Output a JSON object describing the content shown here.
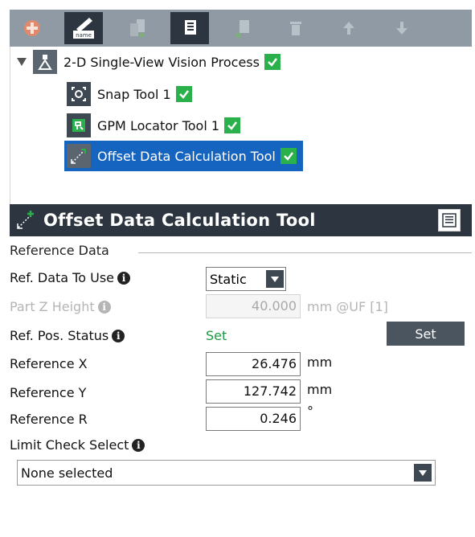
{
  "toolbar": {
    "buttons": [
      {
        "name": "add-icon"
      },
      {
        "name": "rename-icon",
        "label": "name"
      },
      {
        "name": "copy-icon"
      },
      {
        "name": "paste-icon"
      },
      {
        "name": "paste-disabled-icon"
      },
      {
        "name": "delete-icon"
      },
      {
        "name": "move-up-icon"
      },
      {
        "name": "move-down-icon"
      }
    ]
  },
  "tree": {
    "root": {
      "label": "2-D Single-View Vision Process",
      "checked": true
    },
    "children": [
      {
        "label": "Snap Tool 1",
        "checked": true
      },
      {
        "label": "GPM Locator Tool 1",
        "checked": true
      },
      {
        "label": "Offset Data Calculation Tool",
        "checked": true,
        "selected": true
      }
    ]
  },
  "panel": {
    "title": "Offset Data Calculation Tool"
  },
  "form": {
    "section": "Reference Data",
    "ref_data_to_use": {
      "label": "Ref. Data To Use",
      "value": "Static"
    },
    "part_z_height": {
      "label": "Part Z Height",
      "value": "40.000",
      "unit": "mm @UF [1]"
    },
    "ref_pos_status": {
      "label": "Ref. Pos. Status",
      "value": "Set",
      "button": "Set"
    },
    "reference_x": {
      "label": "Reference X",
      "value": "26.476",
      "unit": "mm"
    },
    "reference_y": {
      "label": "Reference Y",
      "value": "127.742",
      "unit": "mm"
    },
    "reference_r": {
      "label": "Reference R",
      "value": "0.246",
      "unit": "°"
    },
    "limit_check": {
      "label": "Limit Check Select",
      "value": "None selected"
    }
  },
  "colors": {
    "toolbar_bg": "#8f9aa5",
    "header_bg": "#2d3640",
    "selection": "#1565c0",
    "check": "#2bb14b",
    "status_ok": "#1a9b3f"
  }
}
